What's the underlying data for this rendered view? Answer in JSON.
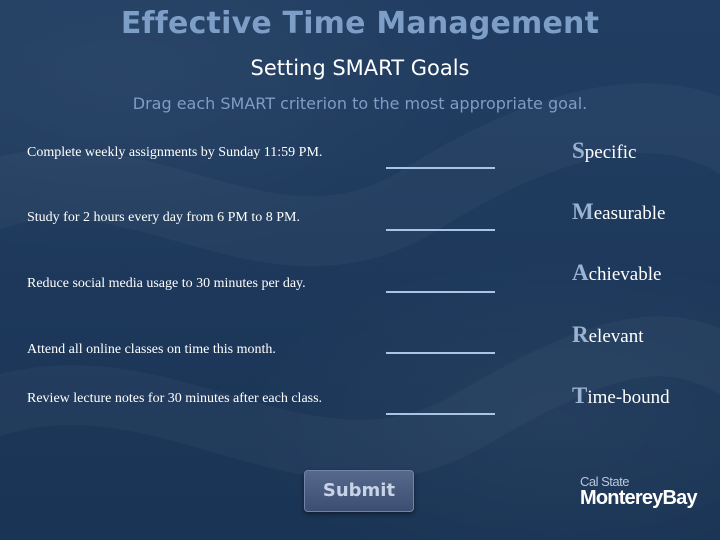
{
  "header": {
    "title": "Effective Time Management",
    "subtitle": "Setting SMART Goals",
    "instruction": "Drag each SMART criterion to the most appropriate goal."
  },
  "goals": [
    "Complete weekly assignments by Sunday 11:59 PM.",
    "Study for 2 hours every day from 6 PM to 8 PM.",
    "Reduce social media usage to 30 minutes per day.",
    "Attend all online classes on time this month.",
    "Review lecture notes for 30 minutes after each class."
  ],
  "criteria": [
    {
      "first": "S",
      "rest": "pecific"
    },
    {
      "first": "M",
      "rest": "easurable"
    },
    {
      "first": "A",
      "rest": "chievable"
    },
    {
      "first": "R",
      "rest": "elevant"
    },
    {
      "first": "T",
      "rest": "ime-bound"
    }
  ],
  "submit_label": "Submit",
  "logo": {
    "top": "Cal State",
    "bottom": "MontereyBay"
  },
  "colors": {
    "background": "#1f3a5c",
    "accent": "#7d9ec6",
    "drop_line": "#a9c4e6"
  }
}
